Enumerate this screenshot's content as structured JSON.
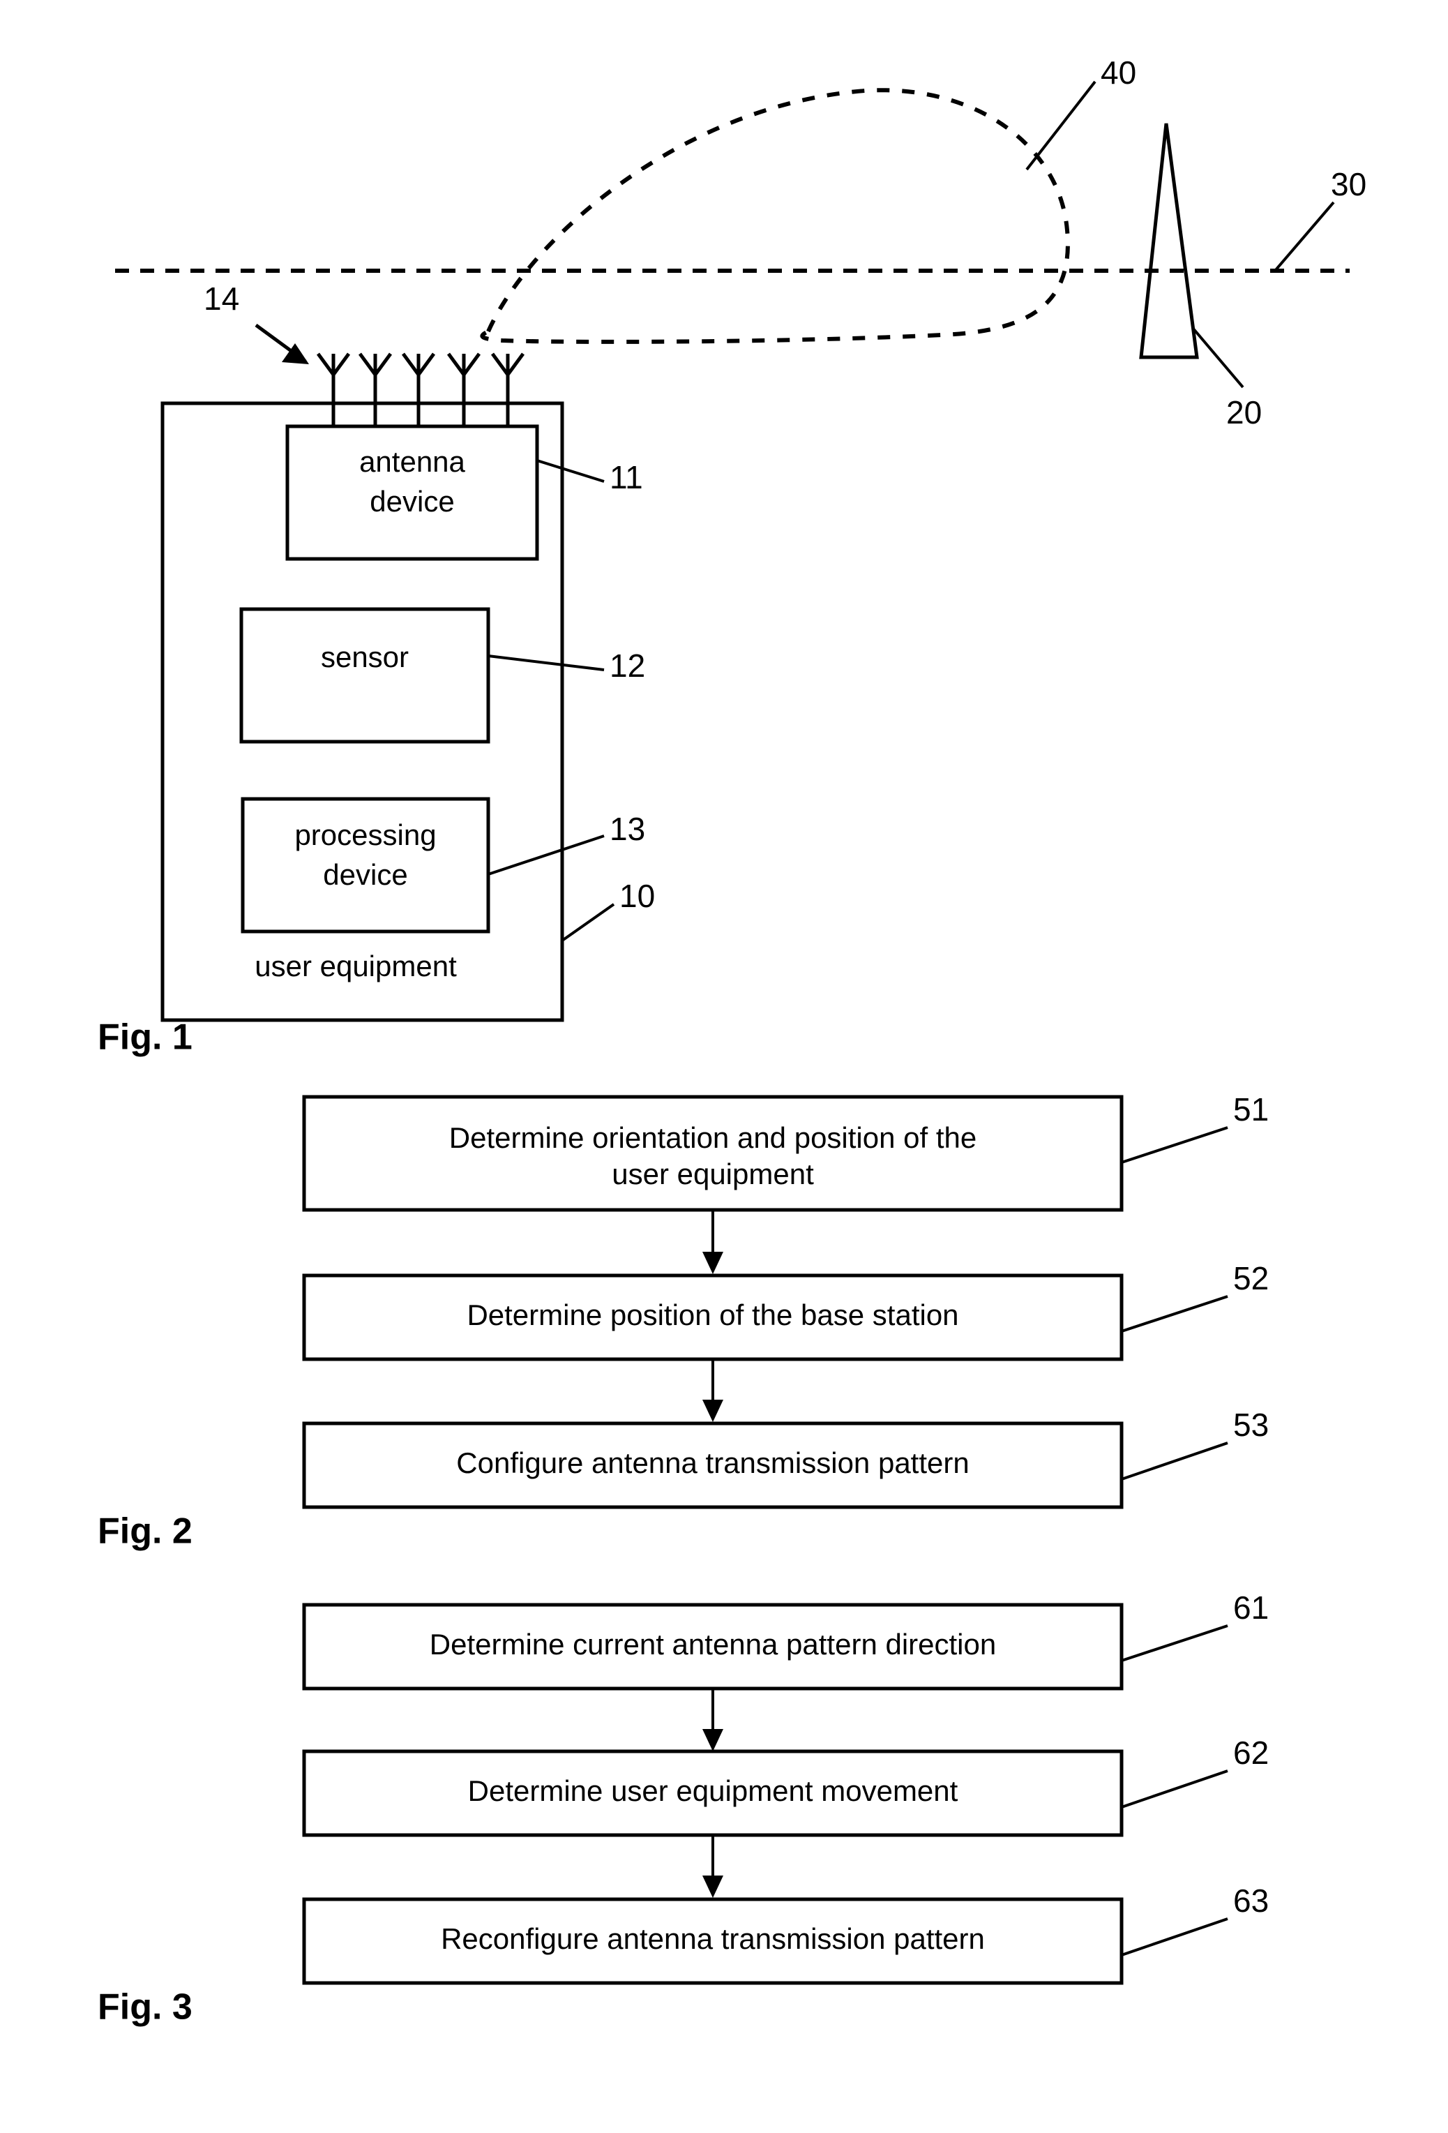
{
  "document": {
    "type": "patent-drawing-sheet",
    "ink_color": "#000000",
    "background_color": "#ffffff"
  },
  "figures": [
    {
      "id": "fig1",
      "label": "Fig. 1",
      "caption_label": "Fig. 1",
      "elements": {
        "user_equipment_label": "user equipment",
        "antenna_device_label": "antenna device",
        "antenna_device_line1": "antenna",
        "antenna_device_line2": "device",
        "sensor_label": "sensor",
        "processing_device_label": "processing device",
        "processing_device_line1": "processing",
        "processing_device_line2": "device",
        "antenna_array_count": 5
      },
      "reference_numerals": [
        {
          "number": "14",
          "target": "antenna-array"
        },
        {
          "number": "11",
          "target": "antenna-device"
        },
        {
          "number": "12",
          "target": "sensor"
        },
        {
          "number": "13",
          "target": "processing-device"
        },
        {
          "number": "10",
          "target": "user-equipment"
        },
        {
          "number": "40",
          "target": "antenna-transmission-pattern-lobe"
        },
        {
          "number": "30",
          "target": "horizon-line"
        },
        {
          "number": "20",
          "target": "base-station-tower"
        }
      ]
    },
    {
      "id": "fig2",
      "label": "Fig. 2",
      "caption_label": "Fig. 2",
      "steps": [
        {
          "number": "51",
          "text": "Determine orientation and position of the user equipment"
        },
        {
          "number": "52",
          "text": "Determine position of the base station"
        },
        {
          "number": "53",
          "text": "Configure antenna transmission pattern"
        }
      ]
    },
    {
      "id": "fig3",
      "label": "Fig. 3",
      "caption_label": "Fig. 3",
      "steps": [
        {
          "number": "61",
          "text": "Determine current antenna pattern direction"
        },
        {
          "number": "62",
          "text": "Determine user equipment movement"
        },
        {
          "number": "63",
          "text": "Reconfigure antenna transmission pattern"
        }
      ]
    }
  ]
}
